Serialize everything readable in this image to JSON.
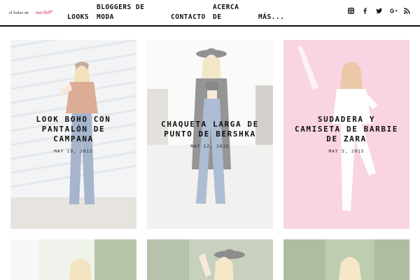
{
  "site": {
    "logo_line1": "el bolso de",
    "logo_line2": "maribel",
    "logo_line3": "com"
  },
  "nav": {
    "items": [
      {
        "label": "LOOKS"
      },
      {
        "label": "BLOGGERS DE"
      },
      {
        "label": "MODA"
      },
      {
        "label": "ACERCA"
      },
      {
        "label": "CONTACTO"
      },
      {
        "label": "DE"
      },
      {
        "label": "MÁS..."
      }
    ]
  },
  "social": [
    "instagram-icon",
    "facebook-icon",
    "twitter-icon",
    "google-plus-icon",
    "rss-icon"
  ],
  "posts": [
    {
      "title_lines": [
        "LOOK BOHO CON",
        "PANTALÓN DE",
        "CAMPANA"
      ],
      "date": "MAY 19, 2015"
    },
    {
      "title_lines": [
        "CHAQUETA LARGA DE",
        "PUNTO DE BERSHKA"
      ],
      "date": "MAY 12, 2015"
    },
    {
      "title_lines": [
        "SUDADERA Y",
        "CAMISETA DE BARBIE",
        "DE ZARA"
      ],
      "date": "MAY 5, 2015"
    }
  ],
  "colors": {
    "accent": "#d6246e",
    "border": "#111111"
  }
}
